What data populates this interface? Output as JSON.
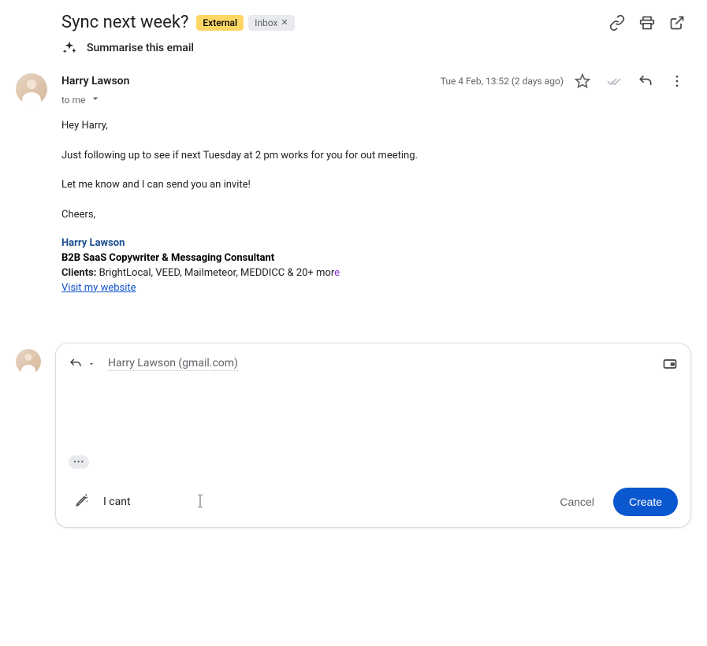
{
  "header": {
    "subject": "Sync next week?",
    "external_badge": "External",
    "inbox_badge": "Inbox"
  },
  "summarise": {
    "label": "Summarise this email"
  },
  "email": {
    "sender_name": "Harry Lawson",
    "timestamp": "Tue 4 Feb, 13:52 (2 days ago)",
    "recipient_label": "to me",
    "body": {
      "greeting": "Hey Harry,",
      "p1": "Just following up to see if next Tuesday at 2 pm works for you for out meeting.",
      "p2": "Let me know and I can send you an invite!",
      "signoff": "Cheers,"
    },
    "signature": {
      "name": "Harry Lawson",
      "title": "B2B SaaS Copywriter & Messaging Consultant",
      "clients_label": "Clients:",
      "clients_text_pre": " BrightLocal, VEED, Mailmeteor, MEDDICC & 20+ mor",
      "clients_text_accent": "e",
      "link_text": "Visit my website"
    }
  },
  "compose": {
    "recipient_display": "Harry Lawson (gmail.com)",
    "trimmed_label": "•••",
    "draft_text": "I cant",
    "cancel_label": "Cancel",
    "create_label": "Create"
  }
}
